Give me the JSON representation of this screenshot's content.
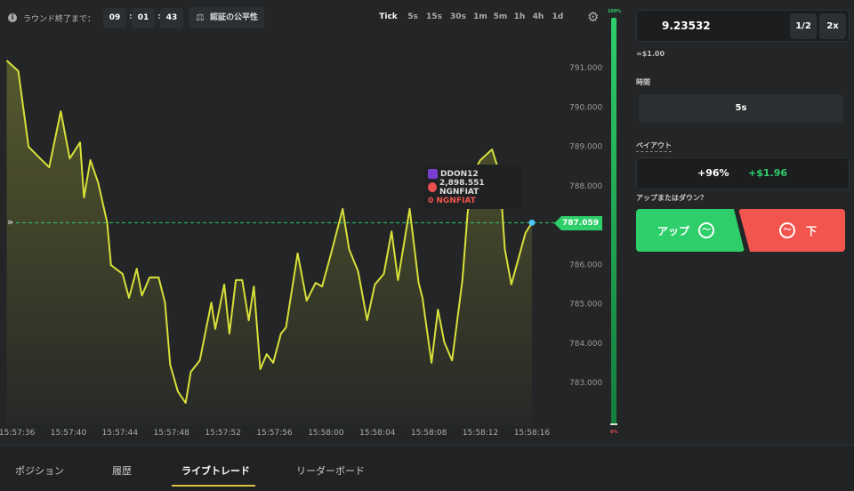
{
  "header": {
    "round_label": "ラウンド終了まで：",
    "timer": [
      "09",
      "01",
      "43"
    ],
    "fairness_label": "認証の公平性",
    "intervals": [
      "Tick",
      "5s",
      "15s",
      "30s",
      "1m",
      "5m",
      "1h",
      "4h",
      "1d"
    ],
    "active_interval": "Tick",
    "progress_top": "100%",
    "progress_bottom": "0%"
  },
  "tooltip": {
    "user": "DDON12",
    "bet": "2,898.551 NGNFIAT",
    "profit": "0 NGNFIAT"
  },
  "colors": {
    "line": "#d8e03a",
    "up": "#2ecf6a",
    "down": "#f2554d",
    "price_tag": "#2ecf6a"
  },
  "chart_data": {
    "type": "line",
    "ylim": [
      782.3,
      791.4
    ],
    "yticks": [
      "791.000",
      "790.000",
      "789.000",
      "788.000",
      "787.000",
      "786.000",
      "785.000",
      "784.000",
      "783.000"
    ],
    "xticks": [
      "15:57:36",
      "15:57:40",
      "15:57:44",
      "15:57:48",
      "15:57:52",
      "15:57:56",
      "15:58:00",
      "15:58:04",
      "15:58:08",
      "15:58:12",
      "15:58:16"
    ],
    "current_price": "787.059",
    "points": [
      [
        "15:57:35.2",
        791.18
      ],
      [
        "15:57:36.1",
        790.91
      ],
      [
        "15:57:36.9",
        788.99
      ],
      [
        "15:57:37.8",
        788.69
      ],
      [
        "15:57:38.5",
        788.47
      ],
      [
        "15:57:39.4",
        789.89
      ],
      [
        "15:57:40.1",
        788.69
      ],
      [
        "15:57:40.9",
        789.1
      ],
      [
        "15:57:41.2",
        787.7
      ],
      [
        "15:57:41.7",
        788.65
      ],
      [
        "15:57:42.3",
        788.08
      ],
      [
        "15:57:43.0",
        787.07
      ],
      [
        "15:57:43.3",
        785.98
      ],
      [
        "15:57:44.2",
        785.76
      ],
      [
        "15:57:44.7",
        785.15
      ],
      [
        "15:57:45.3",
        785.89
      ],
      [
        "15:57:45.7",
        785.21
      ],
      [
        "15:57:46.3",
        785.67
      ],
      [
        "15:57:47.0",
        785.67
      ],
      [
        "15:57:47.5",
        785.03
      ],
      [
        "15:57:47.9",
        783.45
      ],
      [
        "15:57:48.5",
        782.77
      ],
      [
        "15:57:49.1",
        782.48
      ],
      [
        "15:57:49.5",
        783.27
      ],
      [
        "15:57:50.2",
        783.56
      ],
      [
        "15:57:51.1",
        785.03
      ],
      [
        "15:57:51.4",
        784.36
      ],
      [
        "15:57:52.1",
        785.49
      ],
      [
        "15:57:52.5",
        784.24
      ],
      [
        "15:57:53.0",
        785.6
      ],
      [
        "15:57:53.5",
        785.6
      ],
      [
        "15:57:54.0",
        784.58
      ],
      [
        "15:57:54.4",
        785.44
      ],
      [
        "15:57:54.9",
        783.34
      ],
      [
        "15:57:55.4",
        783.72
      ],
      [
        "15:57:55.9",
        783.5
      ],
      [
        "15:57:56.5",
        784.24
      ],
      [
        "15:57:56.9",
        784.4
      ],
      [
        "15:57:57.8",
        786.28
      ],
      [
        "15:57:58.5",
        785.08
      ],
      [
        "15:57:59.2",
        785.53
      ],
      [
        "15:57:59.7",
        785.44
      ],
      [
        "15:58:00.4",
        786.28
      ],
      [
        "15:58:01.3",
        787.41
      ],
      [
        "15:58:01.8",
        786.39
      ],
      [
        "15:58:02.5",
        785.82
      ],
      [
        "15:58:03.2",
        784.58
      ],
      [
        "15:58:03.8",
        785.49
      ],
      [
        "15:58:04.5",
        785.76
      ],
      [
        "15:58:05.1",
        786.84
      ],
      [
        "15:58:05.6",
        785.6
      ],
      [
        "15:58:06.5",
        787.41
      ],
      [
        "15:58:07.2",
        785.53
      ],
      [
        "15:58:07.5",
        785.15
      ],
      [
        "15:58:08.2",
        783.5
      ],
      [
        "15:58:08.7",
        784.85
      ],
      [
        "15:58:09.2",
        784.02
      ],
      [
        "15:58:09.8",
        783.56
      ],
      [
        "15:58:10.6",
        785.6
      ],
      [
        "15:58:11.0",
        787.29
      ],
      [
        "15:58:11.4",
        788.31
      ],
      [
        "15:58:12.0",
        788.65
      ],
      [
        "15:58:12.9",
        788.92
      ],
      [
        "15:58:13.5",
        788.31
      ],
      [
        "15:58:13.9",
        786.39
      ],
      [
        "15:58:14.4",
        785.49
      ],
      [
        "15:58:15.5",
        786.8
      ],
      [
        "15:58:16.0",
        787.059
      ]
    ]
  },
  "panel": {
    "amount": "9.23532",
    "half": "1/2",
    "double": "2x",
    "usd": "≈$1.00",
    "time_label": "時間",
    "duration": "5s",
    "payout_label": "ペイアウト",
    "payout_pct": "+96%",
    "payout_usd": "+$1.96",
    "question": "アップまたはダウン？",
    "up": "アップ",
    "down": "下"
  },
  "tabs": [
    "ポジション",
    "履歴",
    "ライブトレード",
    "リーダーボード"
  ],
  "active_tab": "ライブトレード"
}
